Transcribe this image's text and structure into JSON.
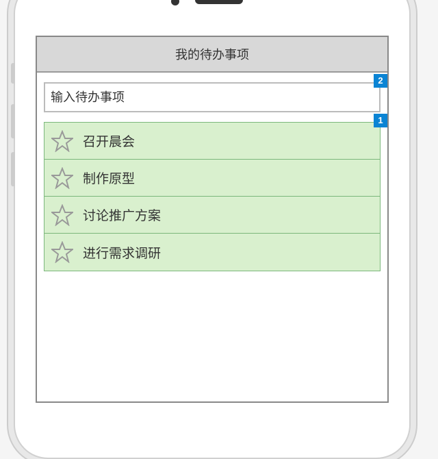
{
  "header": {
    "title": "我的待办事项"
  },
  "input": {
    "placeholder": "输入待办事项",
    "value": ""
  },
  "markers": {
    "top": "2",
    "list": "1"
  },
  "todos": [
    {
      "label": "召开晨会"
    },
    {
      "label": "制作原型"
    },
    {
      "label": "讨论推广方案"
    },
    {
      "label": "进行需求调研"
    }
  ]
}
